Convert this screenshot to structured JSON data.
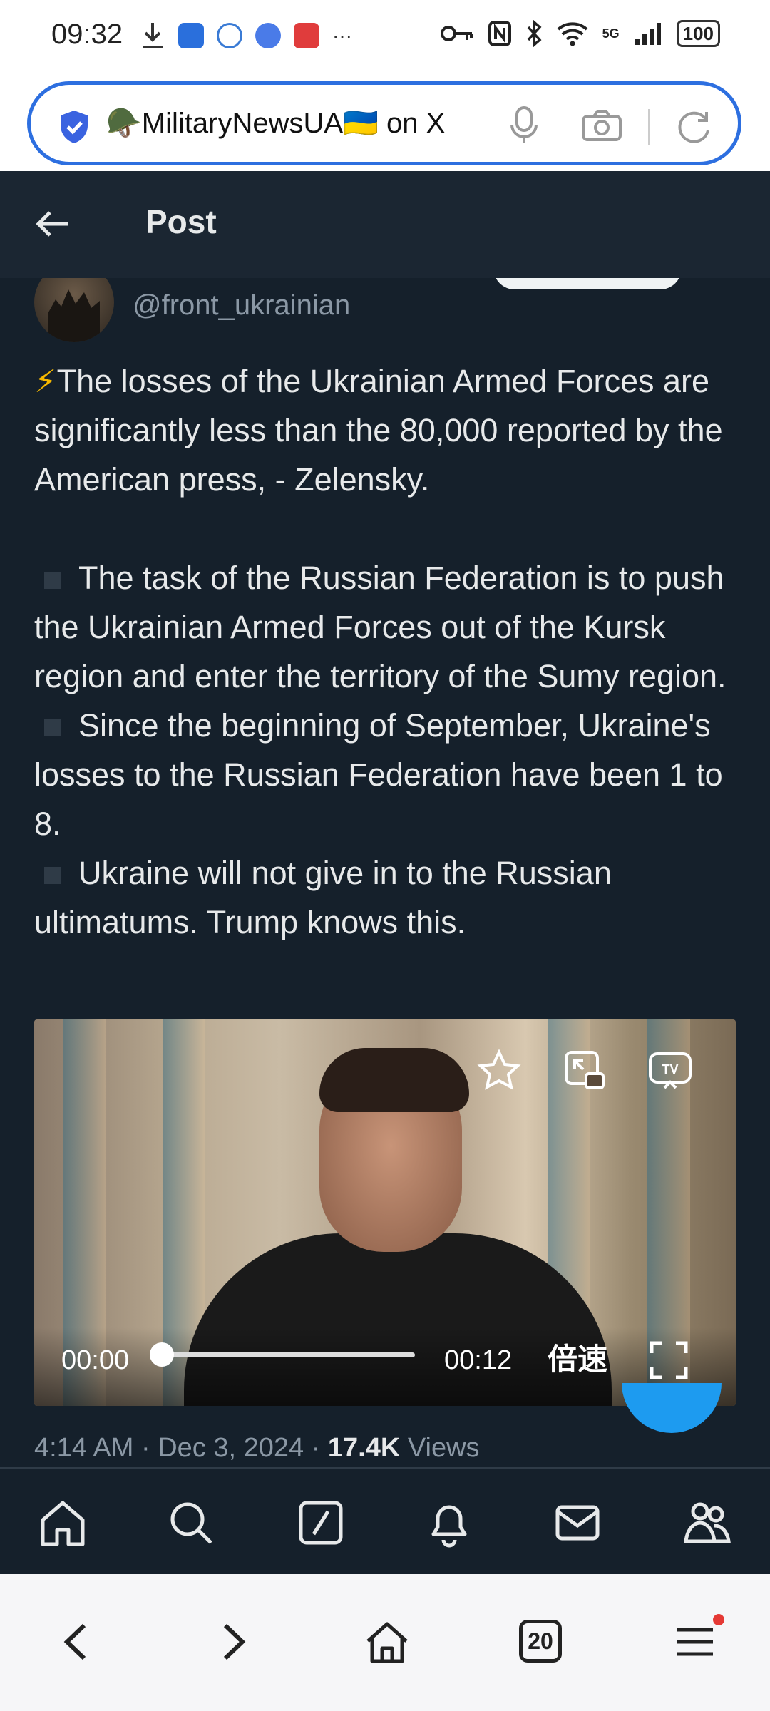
{
  "status_bar": {
    "time": "09:32",
    "network": "5G",
    "battery": "100"
  },
  "browser": {
    "url_title": "🪖MilitaryNewsUA🇺🇦 on X",
    "tab_count": "20"
  },
  "post_header": {
    "title": "Post"
  },
  "author": {
    "handle": "@front_ukrainian"
  },
  "tweet": {
    "headline": "The losses of the Ukrainian Armed Forces are significantly less than the 80,000 reported by the American press, - Zelensky.",
    "headline_emoji": "⚡",
    "bullets": [
      "The task of the Russian Federation is to push the Ukrainian Armed Forces out of the Kursk region and enter the territory of the Sumy region.",
      "Since the beginning of September, Ukraine's losses to the Russian Federation have been 1 to 8.",
      "Ukraine will not give in to the Russian ultimatums. Trump knows this."
    ]
  },
  "video": {
    "current_time": "00:00",
    "duration": "00:12",
    "speed_label": "倍速",
    "progress": 0
  },
  "meta": {
    "time": "4:14 AM · Dec 3, 2024 · ",
    "views_count": "17.4K",
    "views_label": " Views"
  },
  "colors": {
    "background": "#15202b",
    "accent": "#1d9bf0",
    "url_border": "#2d6fe0"
  }
}
